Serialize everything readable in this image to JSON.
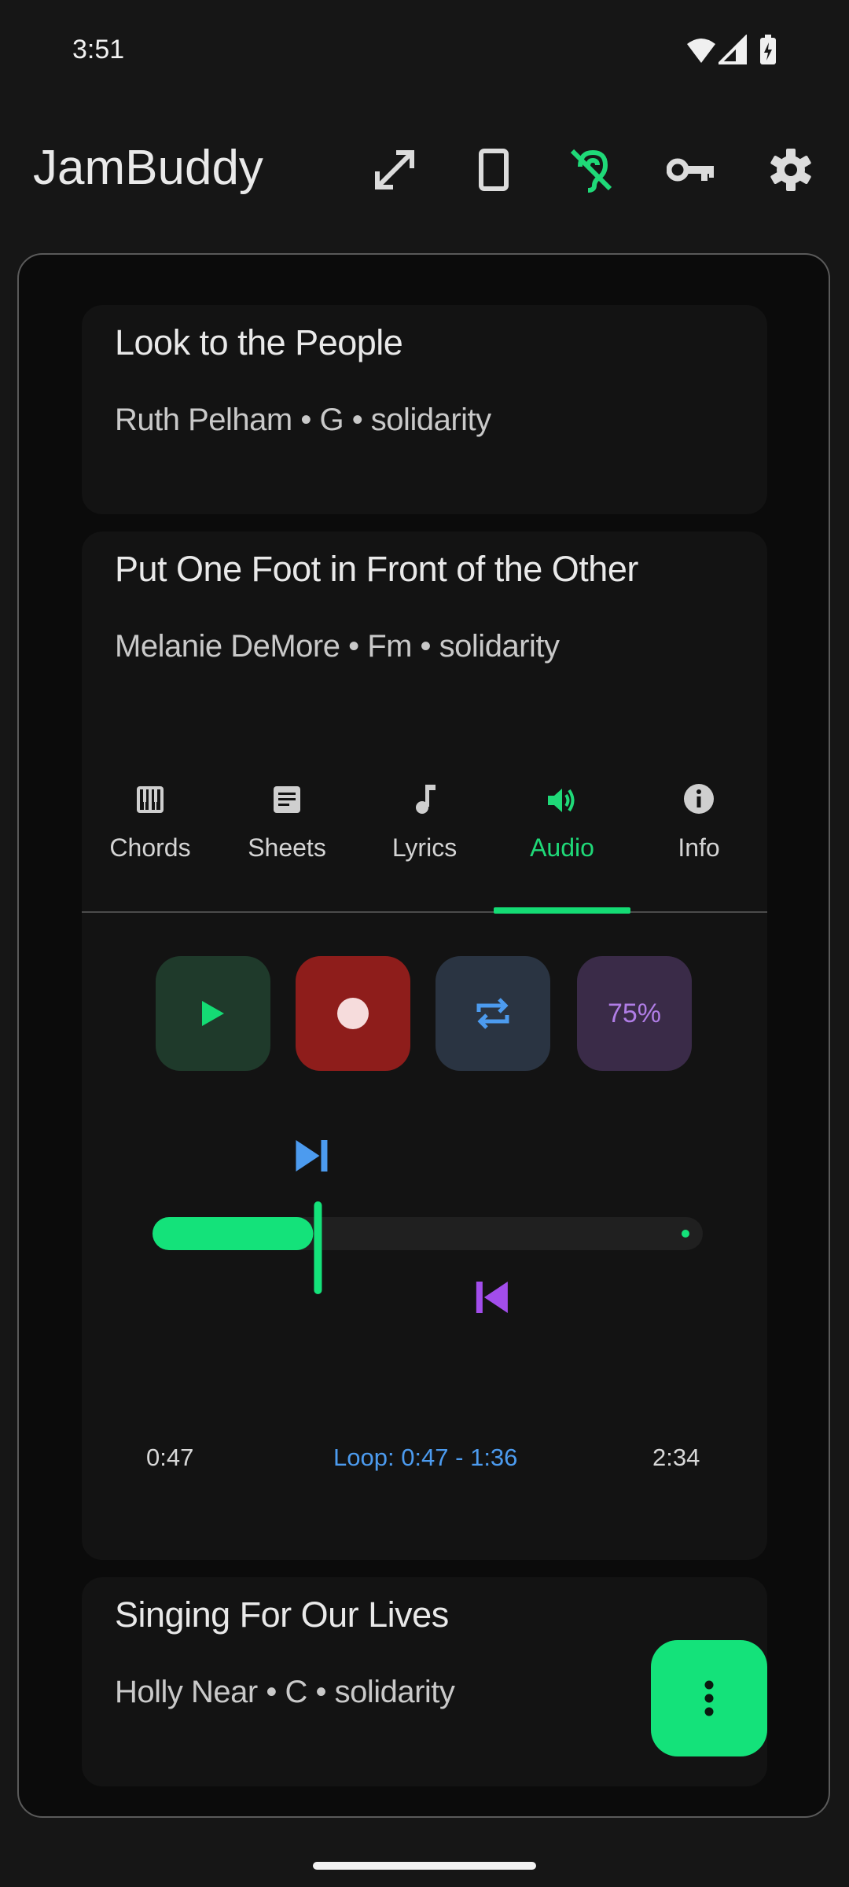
{
  "status_bar": {
    "time": "3:51"
  },
  "app_bar": {
    "title": "JamBuddy"
  },
  "songs": [
    {
      "title": "Look to the People",
      "meta": "Ruth Pelham • G • solidarity"
    },
    {
      "title": "Put One Foot in Front of the Other",
      "meta": "Melanie DeMore • Fm • solidarity"
    },
    {
      "title": "Singing For Our Lives",
      "meta": "Holly Near • C • solidarity"
    }
  ],
  "tabs": [
    {
      "label": "Chords",
      "icon": "piano-icon"
    },
    {
      "label": "Sheets",
      "icon": "sheet-icon"
    },
    {
      "label": "Lyrics",
      "icon": "music-note-icon"
    },
    {
      "label": "Audio",
      "icon": "volume-icon",
      "active": true
    },
    {
      "label": "Info",
      "icon": "info-icon"
    }
  ],
  "audio": {
    "speed": "75%",
    "time_current": "0:47",
    "loop_text": "Loop: 0:47 - 1:36",
    "time_total": "2:34",
    "progress_fraction": 0.305,
    "loop_start_fraction": 0.305,
    "loop_end_fraction": 0.623
  },
  "colors": {
    "accent": "#14DB74",
    "record": "#8E1D1B",
    "loop_blue": "#4C9BEF",
    "loop_purple": "#A24DEB"
  }
}
